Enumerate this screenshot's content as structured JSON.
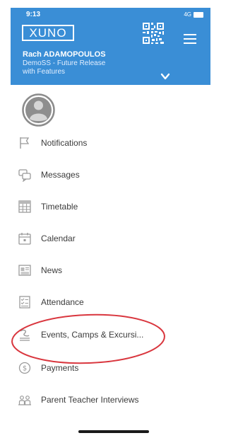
{
  "status_bar": {
    "time": "9:13",
    "signal": "4G"
  },
  "header": {
    "logo": "XUNO",
    "user_name": "Rach ADAMOPOULOS",
    "school_line1": "DemoSS - Future Release",
    "school_line2": "with Features",
    "icons": {
      "qr": "qr-code-icon",
      "menu": "hamburger-menu-icon",
      "expand": "chevron-down-icon"
    }
  },
  "menu": {
    "items": [
      {
        "label": "Notifications",
        "icon": "flag-icon"
      },
      {
        "label": "Messages",
        "icon": "chat-icon"
      },
      {
        "label": "Timetable",
        "icon": "grid-icon"
      },
      {
        "label": "Calendar",
        "icon": "calendar-icon"
      },
      {
        "label": "News",
        "icon": "newspaper-icon"
      },
      {
        "label": "Attendance",
        "icon": "attendance-icon"
      },
      {
        "label": "Events, Camps & Excursi...",
        "icon": "event-icon"
      },
      {
        "label": "Payments",
        "icon": "dollar-icon"
      },
      {
        "label": "Parent Teacher Interviews",
        "icon": "people-icon"
      }
    ]
  },
  "colors": {
    "header": "#3a8ed6",
    "highlight_ring": "#d9363e",
    "menu_text": "#3b3b3b",
    "icon": "#9a9a9a"
  }
}
